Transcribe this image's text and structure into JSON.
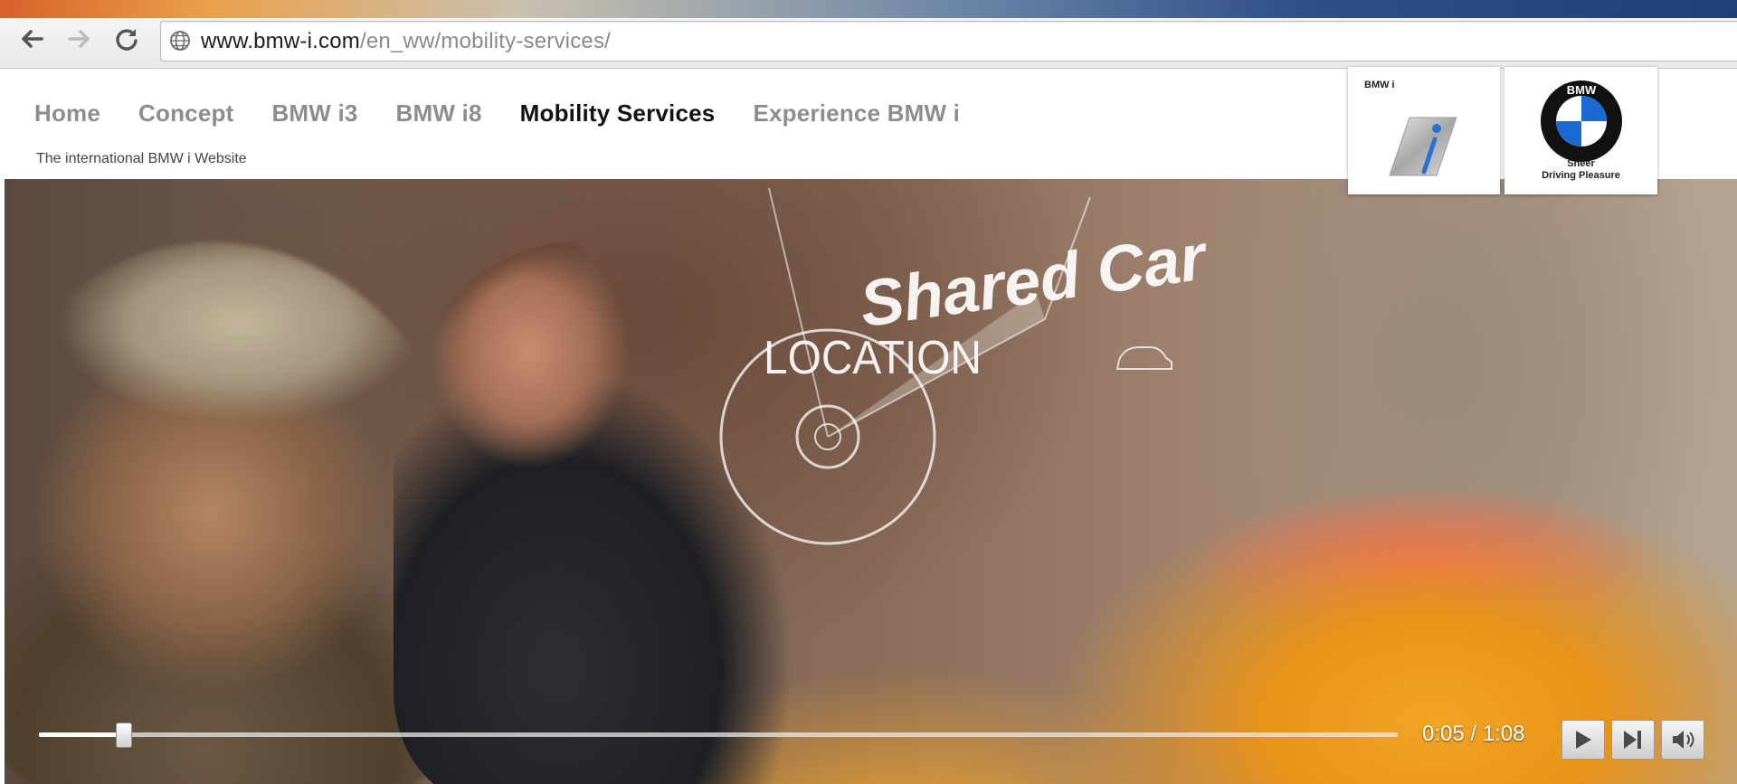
{
  "browser": {
    "back_icon": "arrow-left-icon",
    "forward_icon": "arrow-right-icon",
    "reload_icon": "reload-icon",
    "url_host": "www.bmw-i.com",
    "url_path": "/en_ww/mobility-services/"
  },
  "site": {
    "nav": [
      {
        "label": "Home",
        "active": false
      },
      {
        "label": "Concept",
        "active": false
      },
      {
        "label": "BMW i3",
        "active": false
      },
      {
        "label": "BMW i8",
        "active": false
      },
      {
        "label": "Mobility Services",
        "active": true
      },
      {
        "label": "Experience BMW i",
        "active": false
      }
    ],
    "tagline": "The international BMW i Website",
    "bmwi_logo_text": "BMW i",
    "bmw_logo_text": "BMW",
    "bmw_claim_line1": "Sheer",
    "bmw_claim_line2": "Driving Pleasure"
  },
  "video": {
    "overlay_title": "Shared Car",
    "overlay_subtitle": "LOCATION",
    "progress": 0.062,
    "current_time": "0:05",
    "duration": "1:08",
    "time_separator": " / ",
    "controls": [
      "play-icon",
      "next-icon",
      "volume-icon"
    ]
  },
  "colors": {
    "nav_inactive": "#8d8d8d",
    "nav_active": "#111111",
    "taxi_yellow": "#f2a423",
    "bmw_blue": "#1c69d4"
  }
}
